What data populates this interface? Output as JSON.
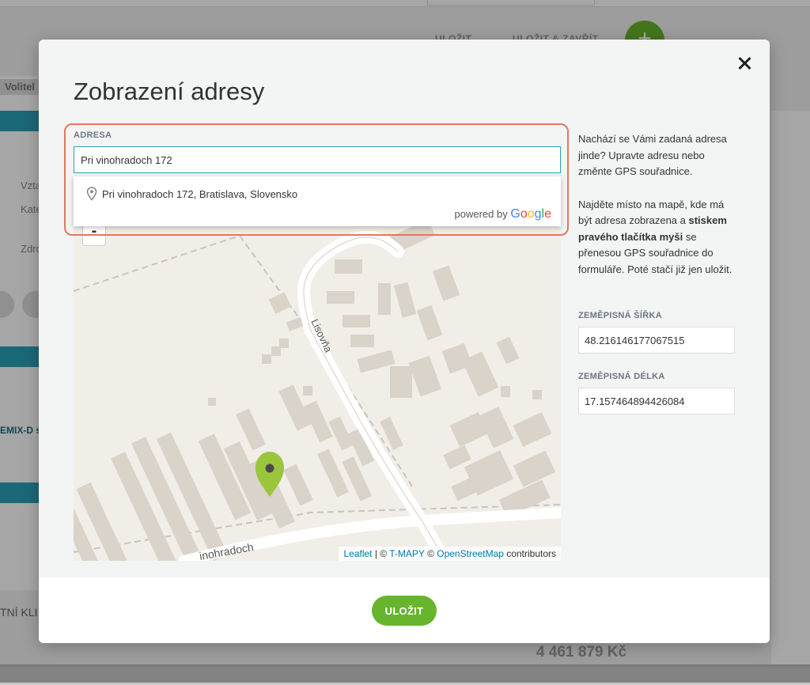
{
  "background": {
    "top_buttons": [
      "ULOŽIT",
      "ULOŽIT & ZAVŘÍT"
    ],
    "fab_label": "+",
    "side_label": "Volitel",
    "side_texts": [
      "Vzta",
      "Kate",
      "Zdro"
    ],
    "company": "EMIX-D s.",
    "client_label": "TNÍ KLI",
    "amount": "4 461 879 Kč"
  },
  "modal": {
    "title": "Zobrazení adresy",
    "address": {
      "label": "ADRESA",
      "value": "Pri vinohradoch 172",
      "suggestion": "Pri vinohradoch 172, Bratislava, Slovensko",
      "powered_by": "powered by",
      "google": [
        "G",
        "o",
        "o",
        "g",
        "l",
        "e"
      ]
    },
    "map": {
      "zoom_out": "-",
      "street_1": "Lisovňa",
      "street_2": "inohradoch",
      "attribution": {
        "leaflet": "Leaflet",
        "sep1": " | © ",
        "tmapy": "T-MAPY",
        "sep2": " © ",
        "osm": "OpenStreetMap",
        "contributors": " contributors"
      },
      "marker_color": "#9bc53d"
    },
    "info": {
      "p1": "Nachází se Vámi zadaná adresa jinde? Upravte adresu nebo změnte GPS souřadnice.",
      "p2_start": "Najděte místo na mapě, kde má být adresa zobrazena a ",
      "p2_bold": "stiskem pravého tlačítka myši",
      "p2_end": " se přenesou GPS souřadnice do formuláře. Poté stačí již jen uložit."
    },
    "latitude": {
      "label": "ZEMĚPISNÁ ŠÍŘKA",
      "value": "48.216146177067515"
    },
    "longitude": {
      "label": "ZEMĚPISNÁ DÉLKA",
      "value": "17.157464894426084"
    },
    "save_label": "ULOŽIT",
    "colors": {
      "accent": "#67b52c",
      "focus": "#2aa0b7",
      "highlight": "#e4775f"
    }
  }
}
